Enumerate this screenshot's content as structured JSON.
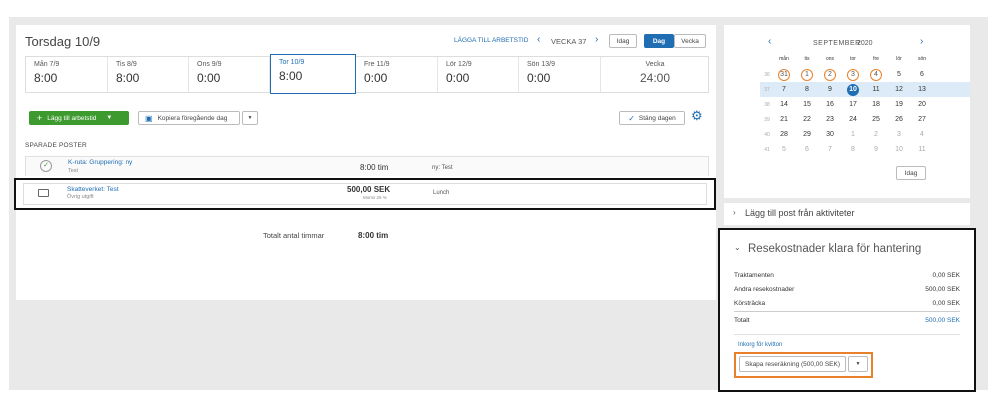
{
  "header": {
    "date_title": "Torsdag 10/9",
    "add_worktime_link": "LÄGGA TILL ARBETSTID",
    "week_label": "VECKA 37",
    "today_btn": "Idag",
    "view_day": "Dag",
    "view_week": "Vecka"
  },
  "days": [
    {
      "label": "Mån 7/9",
      "value": "8:00"
    },
    {
      "label": "Tis 8/9",
      "value": "8:00"
    },
    {
      "label": "Ons 9/9",
      "value": "0:00"
    },
    {
      "label": "Tor 10/9",
      "value": "8:00"
    },
    {
      "label": "Fre 11/9",
      "value": "0:00"
    },
    {
      "label": "Lör 12/9",
      "value": "0:00"
    },
    {
      "label": "Sön 13/9",
      "value": "0:00"
    }
  ],
  "week_total": {
    "label": "Vecka",
    "value": "24:00"
  },
  "toolbar": {
    "add_worktime": "Lägg till arbetstid",
    "copy_prev": "Kopiera föregående dag",
    "close_day": "Stäng dagen"
  },
  "saved": {
    "heading": "SPARADE POSTER",
    "items": [
      {
        "title": "K-ruta: Gruppering: ny",
        "sub": "Test",
        "amount": "8:00 tim",
        "amount_sub": "",
        "note": "ny: Test"
      },
      {
        "title": "Skatteverket: Test",
        "sub": "Övrig utgift",
        "amount": "500,00 SEK",
        "amount_sub": "Moms 25 %",
        "note": "Lunch"
      }
    ],
    "total_label": "Totalt antal timmar",
    "total_value": "8:00 tim"
  },
  "calendar": {
    "month": "SEPTEMBER",
    "year": "2020",
    "weekdays": [
      "mån",
      "tis",
      "ons",
      "tor",
      "fre",
      "lör",
      "sön"
    ],
    "weeks": [
      {
        "wk": "36",
        "days": [
          "31",
          "1",
          "2",
          "3",
          "4",
          "5",
          "6"
        ]
      },
      {
        "wk": "37",
        "days": [
          "7",
          "8",
          "9",
          "10",
          "11",
          "12",
          "13"
        ]
      },
      {
        "wk": "38",
        "days": [
          "14",
          "15",
          "16",
          "17",
          "18",
          "19",
          "20"
        ]
      },
      {
        "wk": "39",
        "days": [
          "21",
          "22",
          "23",
          "24",
          "25",
          "26",
          "27"
        ]
      },
      {
        "wk": "40",
        "days": [
          "28",
          "29",
          "30",
          "1",
          "2",
          "3",
          "4"
        ]
      },
      {
        "wk": "41",
        "days": [
          "5",
          "6",
          "7",
          "8",
          "9",
          "10",
          "11"
        ]
      }
    ],
    "today_btn": "Idag"
  },
  "activities": {
    "label": "Lägg till post från aktiviteter"
  },
  "expenses": {
    "title": "Resekostnader klara för hantering",
    "rows": [
      {
        "label": "Traktamenten",
        "value": "0,00 SEK"
      },
      {
        "label": "Andra resekostnader",
        "value": "500,00 SEK"
      },
      {
        "label": "Körsträcka",
        "value": "0,00 SEK"
      }
    ],
    "total_label": "Totalt",
    "total_value": "500,00 SEK",
    "inbox_link": "Inkorg för kvitton",
    "create_btn": "Skapa reseräkning (500,00 SEK)"
  },
  "colors": {
    "accent": "#1f6db3",
    "green": "#3c9a2e",
    "highlight": "#e8812a"
  }
}
